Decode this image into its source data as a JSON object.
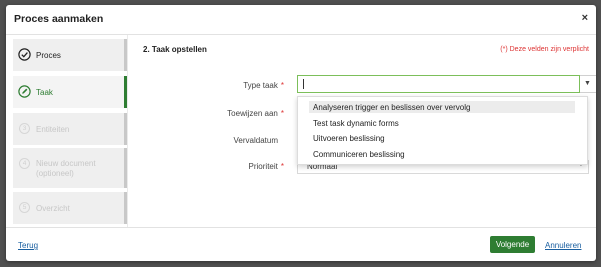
{
  "modal": {
    "title": "Proces aanmaken",
    "close_symbol": "×"
  },
  "wizard": {
    "steps": [
      {
        "label": "Proces",
        "state": "done",
        "icon": "check-circle-icon"
      },
      {
        "label": "Taak",
        "state": "active",
        "icon": "pencil-icon"
      },
      {
        "number": "3",
        "label": "Entiteiten",
        "state": "disabled"
      },
      {
        "number": "4",
        "label": "Nieuw document",
        "sub": "(optioneel)",
        "state": "disabled"
      },
      {
        "number": "5",
        "label": "Overzicht",
        "state": "disabled"
      }
    ]
  },
  "form": {
    "section_title": "2. Taak opstellen",
    "required_note": "(*) Deze velden zijn verplicht",
    "required_marker": "*",
    "fields": {
      "type_taak": {
        "label": "Type taak",
        "value": ""
      },
      "toewijzen_aan": {
        "label": "Toewijzen aan"
      },
      "vervaldatum": {
        "label": "Vervaldatum"
      },
      "prioriteit": {
        "label": "Prioriteit",
        "value": "Normaal"
      }
    },
    "dropdown_options": [
      "Analyseren trigger en beslissen over vervolg",
      "Test task dynamic forms",
      "Uitvoeren beslissing",
      "Communiceren beslissing"
    ],
    "highlighted_option_index": 0
  },
  "footer": {
    "back_label": "Terug",
    "next_label": "Volgende",
    "cancel_label": "Annuleren"
  },
  "colors": {
    "accent_green": "#2e7d32",
    "focus_border": "#7cbf5a",
    "required_red": "#dd3333",
    "link_blue": "#1a5fa0"
  }
}
